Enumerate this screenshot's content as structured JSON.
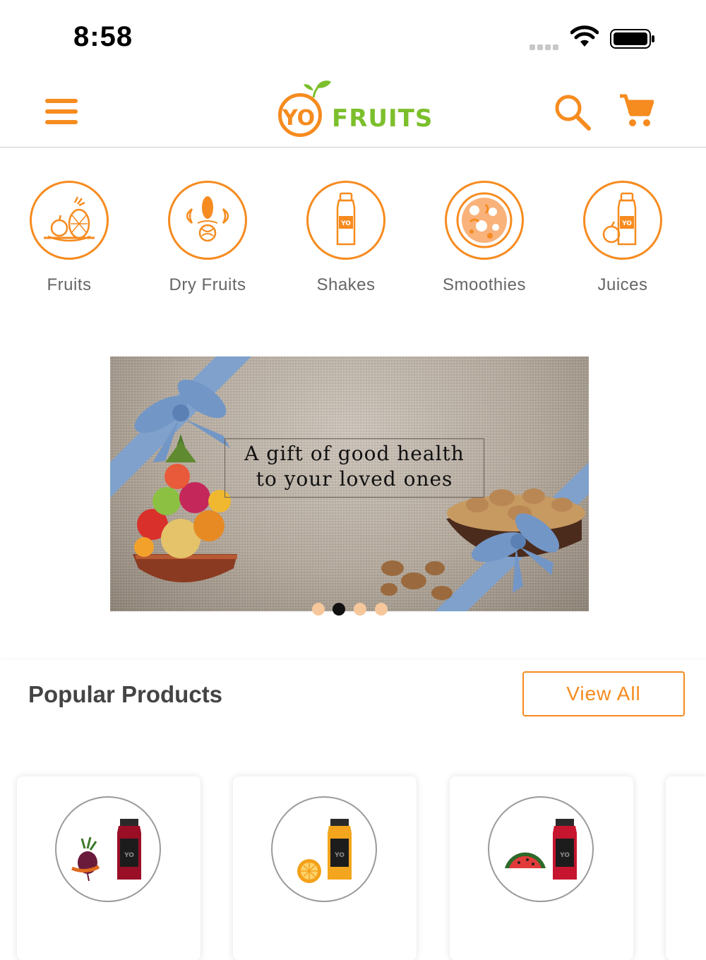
{
  "status_bar": {
    "time": "8:58"
  },
  "header": {
    "logo_yo": "YO",
    "logo_fruits": "FRUITS"
  },
  "categories": [
    {
      "label": "Fruits",
      "icon": "fruit-basket-icon"
    },
    {
      "label": "Dry Fruits",
      "icon": "dry-fruits-icon"
    },
    {
      "label": "Shakes",
      "icon": "shake-bottle-icon"
    },
    {
      "label": "Smoothies",
      "icon": "smoothie-bowl-icon"
    },
    {
      "label": "Juices",
      "icon": "juice-bottle-icon"
    }
  ],
  "banner": {
    "line1": "A gift of good health",
    "line2": "to your loved ones",
    "slide_count": 4,
    "active_slide": 2
  },
  "popular": {
    "title": "Popular Products",
    "view_all": "View All",
    "products": [
      {
        "image": "beetroot-juice"
      },
      {
        "image": "orange-juice"
      },
      {
        "image": "watermelon-juice"
      }
    ]
  },
  "colors": {
    "accent": "#f68b1f",
    "brand_green": "#7cbf2c"
  }
}
